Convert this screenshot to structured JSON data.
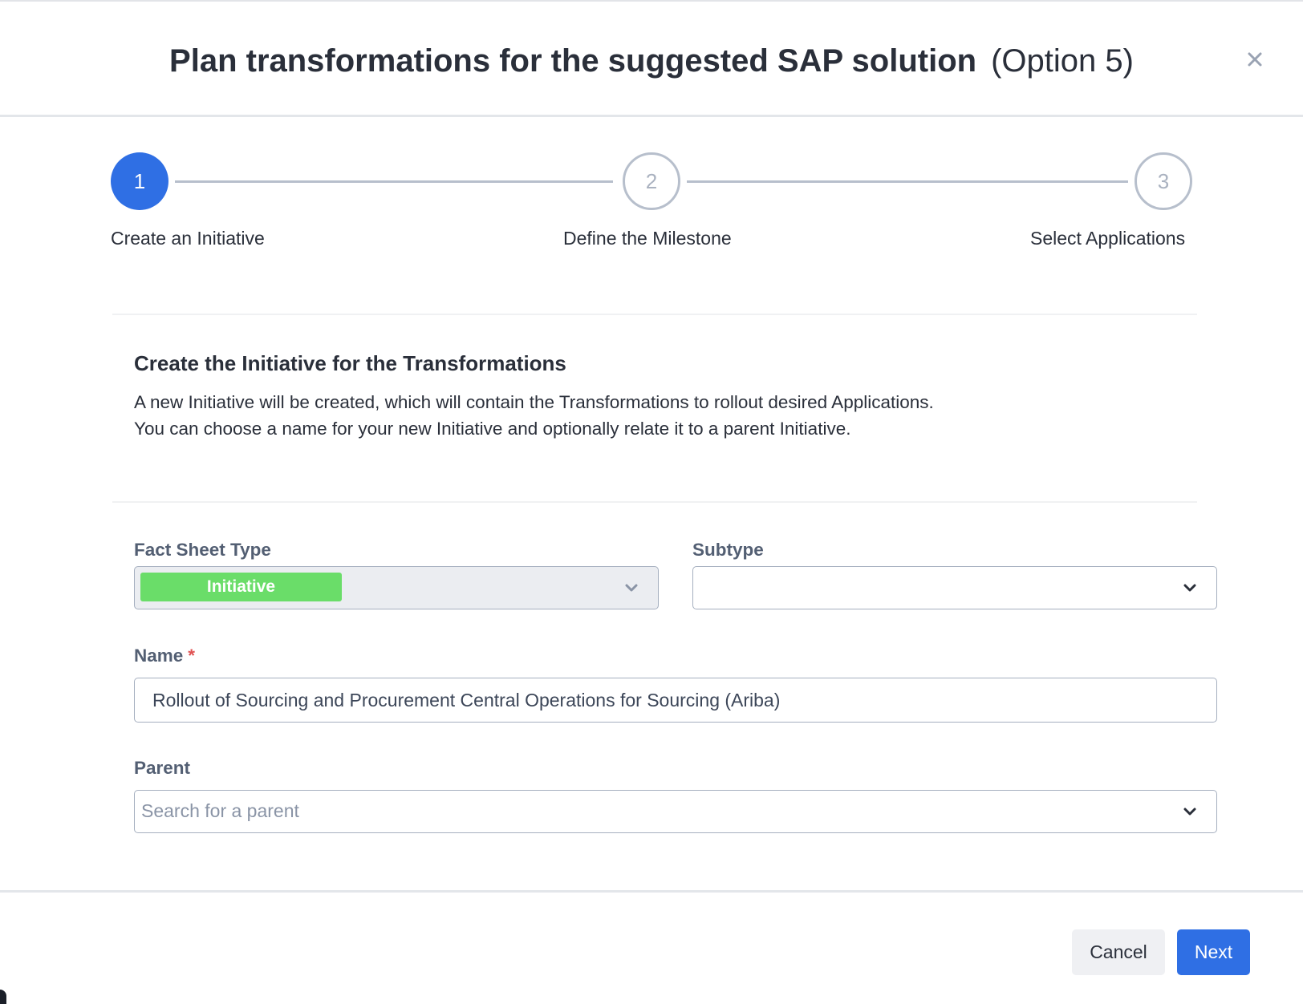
{
  "dialog": {
    "title": "Plan transformations for the suggested SAP solution",
    "title_suffix": "(Option 5)",
    "close_icon": "close-icon"
  },
  "stepper": {
    "current_step": 1,
    "steps": [
      {
        "number": "1",
        "label": "Create an Initiative",
        "state": "active"
      },
      {
        "number": "2",
        "label": "Define the Milestone",
        "state": "inactive"
      },
      {
        "number": "3",
        "label": "Select Applications",
        "state": "inactive"
      }
    ]
  },
  "section": {
    "title": "Create the Initiative for the Transformations",
    "description": "A new Initiative will be created, which will contain the Transformations to rollout desired Applications. You can choose a name for your new Initiative and optionally relate it to a parent Initiative."
  },
  "form": {
    "fact_sheet_type": {
      "label": "Fact Sheet Type",
      "value": "Initiative",
      "badge_color": "#6add69",
      "disabled": true
    },
    "subtype": {
      "label": "Subtype",
      "value": ""
    },
    "name": {
      "label": "Name",
      "required_marker": "*",
      "value": "Rollout of Sourcing and Procurement Central Operations for Sourcing (Ariba)"
    },
    "parent": {
      "label": "Parent",
      "placeholder": "Search for a parent",
      "value": ""
    }
  },
  "footer": {
    "cancel_label": "Cancel",
    "next_label": "Next"
  },
  "colors": {
    "primary": "#2f6fe4",
    "initiative_badge": "#6add69",
    "required": "#e05252"
  }
}
